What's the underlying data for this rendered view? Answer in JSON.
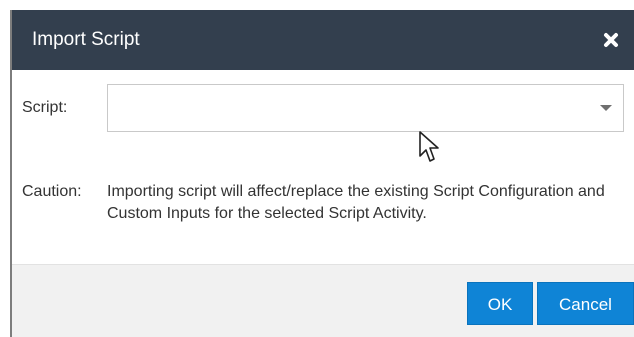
{
  "dialog": {
    "title": "Import Script",
    "close_icon": "close-icon"
  },
  "form": {
    "script_label": "Script:",
    "script_value": "",
    "dropdown_icon": "chevron-down-icon"
  },
  "caution": {
    "label": "Caution:",
    "text": "Importing script will affect/replace the existing Script Configuration and Custom Inputs for the selected Script Activity."
  },
  "buttons": {
    "ok_label": "OK",
    "cancel_label": "Cancel"
  },
  "colors": {
    "title_bar": "#333f4e",
    "primary_button": "#0f84d6",
    "footer": "#f1f1f1"
  }
}
